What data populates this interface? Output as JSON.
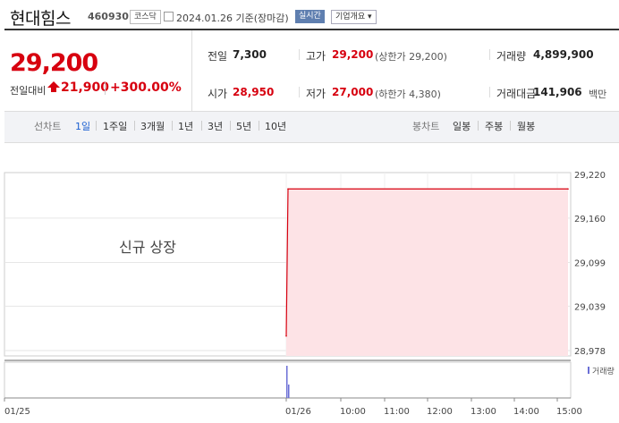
{
  "stock": {
    "name": "현대힘스",
    "code": "460930",
    "market": "코스닥",
    "date": "2024.01.26",
    "basis": "기준(장마감)",
    "realtime_label": "실시간",
    "company_label": "기업개요 ▾"
  },
  "quote": {
    "price": "29,200",
    "change_label": "전일대비",
    "change": "21,900",
    "change_pct": "+300.00%",
    "prev_close_label": "전일",
    "prev_close": "7,300",
    "high_label": "고가",
    "high": "29,200",
    "upper_limit": "(상한가 29,200)",
    "volume_label": "거래량",
    "volume": "4,899,900",
    "open_label": "시가",
    "open": "28,950",
    "low_label": "저가",
    "low": "27,000",
    "lower_limit": "(하한가 4,380)",
    "amount_label": "거래대금",
    "amount": "141,906",
    "amount_unit": "백만"
  },
  "toolbar": {
    "line_label": "선차트",
    "periods": [
      "1일",
      "1주일",
      "3개월",
      "1년",
      "3년",
      "5년",
      "10년"
    ],
    "active_period": 0,
    "candle_label": "봉차트",
    "candles": [
      "일봉",
      "주봉",
      "월봉"
    ]
  },
  "chart_data": {
    "type": "area",
    "annotation": "신규 상장",
    "x_ticks": [
      "01/25",
      "01/26",
      "10:00",
      "11:00",
      "12:00",
      "13:00",
      "14:00",
      "15:00"
    ],
    "y_ticks": [
      29220,
      29160,
      29099,
      29039,
      28978
    ],
    "ylim": [
      28978,
      29220
    ],
    "series": [
      {
        "name": "",
        "x": [
          "01/26 09:00",
          "01/26 09:01",
          "01/26 15:30"
        ],
        "values": [
          28998,
          29200,
          29200
        ]
      }
    ],
    "volume_label": "거래량",
    "colors": {
      "line": "#d7000f",
      "fill": "#fde3e6",
      "volume": "#6b6fd6"
    }
  }
}
